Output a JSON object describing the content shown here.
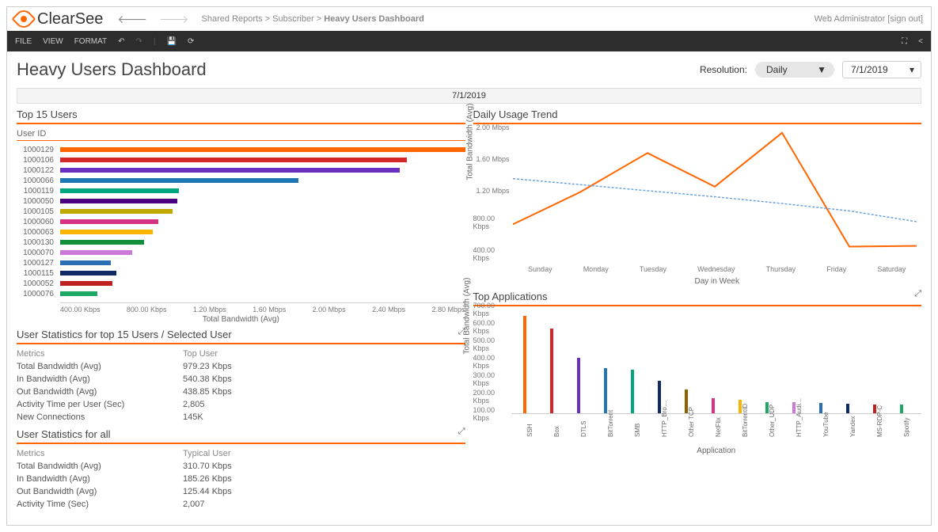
{
  "brand": "ClearSee",
  "breadcrumb": {
    "root": "Shared Reports",
    "mid": "Subscriber",
    "leaf": "Heavy Users Dashboard"
  },
  "user_area": {
    "name": "Web Administrator",
    "signout": "[sign out]"
  },
  "menubar": {
    "file": "FILE",
    "view": "VIEW",
    "format": "FORMAT"
  },
  "page": {
    "title": "Heavy Users Dashboard",
    "resolution_label": "Resolution:",
    "resolution_value": "Daily",
    "date": "7/1/2019",
    "banner_date": "7/1/2019"
  },
  "top15": {
    "title": "Top 15 Users",
    "subtitle": "User ID",
    "users": [
      {
        "id": "1000129",
        "val": 2800,
        "color": "#f60"
      },
      {
        "id": "1000106",
        "val": 2400,
        "color": "#d62728"
      },
      {
        "id": "1000122",
        "val": 2350,
        "color": "#6a2fbd"
      },
      {
        "id": "1000066",
        "val": 1650,
        "color": "#1f77b4"
      },
      {
        "id": "1000119",
        "val": 820,
        "color": "#00a67e"
      },
      {
        "id": "1000050",
        "val": 810,
        "color": "#4b0082"
      },
      {
        "id": "1000105",
        "val": 780,
        "color": "#bfa900"
      },
      {
        "id": "1000060",
        "val": 680,
        "color": "#d63384"
      },
      {
        "id": "1000063",
        "val": 640,
        "color": "#f8b400"
      },
      {
        "id": "1000130",
        "val": 580,
        "color": "#138f3a"
      },
      {
        "id": "1000070",
        "val": 500,
        "color": "#cc79d8"
      },
      {
        "id": "1000127",
        "val": 350,
        "color": "#2a6fb5"
      },
      {
        "id": "1000115",
        "val": 390,
        "color": "#102a66"
      },
      {
        "id": "1000052",
        "val": 360,
        "color": "#c02020"
      },
      {
        "id": "1000076",
        "val": 260,
        "color": "#1ea865"
      }
    ],
    "xticks": [
      "400.00 Kbps",
      "800.00 Kbps",
      "1.20 Mbps",
      "1.60 Mbps",
      "2.00 Mbps",
      "2.40 Mbps",
      "2.80 Mbps"
    ],
    "xlabel": "Total Bandwidth (Avg)"
  },
  "daily": {
    "title": "Daily Usage Trend",
    "ylabel": "Total Bandwidth (Avg)",
    "xlabel": "Day in Week",
    "days": [
      "Sunday",
      "Monday",
      "Tuesday",
      "Wednesday",
      "Thursday",
      "Friday",
      "Saturday"
    ],
    "yticks": [
      "2.00 Mbps",
      "1.60 Mbps",
      "1.20 Mbps",
      "800.00 Kbps",
      "400.00 Kbps"
    ]
  },
  "stats_top15": {
    "title": "User Statistics for top 15 Users / Selected User",
    "h1": "Metrics",
    "h2": "Top User",
    "rows": [
      {
        "m": "Total Bandwidth (Avg)",
        "v": "979.23 Kbps"
      },
      {
        "m": "In Bandwidth (Avg)",
        "v": "540.38 Kbps"
      },
      {
        "m": "Out Bandwidth (Avg)",
        "v": "438.85 Kbps"
      },
      {
        "m": "Activity Time per User (Sec)",
        "v": "2,805"
      },
      {
        "m": "New Connections",
        "v": "145K"
      }
    ]
  },
  "stats_all": {
    "title": "User Statistics for all",
    "h1": "Metrics",
    "h2": "Typical User",
    "rows": [
      {
        "m": "Total Bandwidth (Avg)",
        "v": "310.70 Kbps"
      },
      {
        "m": "In Bandwidth (Avg)",
        "v": "185.26 Kbps"
      },
      {
        "m": "Out Bandwidth (Avg)",
        "v": "125.44 Kbps"
      },
      {
        "m": "Activity Time (Sec)",
        "v": "2,007"
      }
    ]
  },
  "apps": {
    "title": "Top Applications",
    "ylabel": "Total Bandwidth (Avg)",
    "xlabel": "Application",
    "yticks": [
      "700.00 Kbps",
      "600.00 Kbps",
      "500.00 Kbps",
      "400.00 Kbps",
      "300.00 Kbps",
      "200.00 Kbps",
      "100.00 Kbps"
    ],
    "items": [
      {
        "name": "SSH",
        "val": 650,
        "color": "#f60"
      },
      {
        "name": "Box",
        "val": 570,
        "color": "#d62728"
      },
      {
        "name": "DTLS",
        "val": 370,
        "color": "#6a2fbd"
      },
      {
        "name": "BitTorrent",
        "val": 300,
        "color": "#1f77b4"
      },
      {
        "name": "SMB",
        "val": 290,
        "color": "#00a67e"
      },
      {
        "name": "HTTP_Bro…",
        "val": 220,
        "color": "#102a66"
      },
      {
        "name": "Other TCP",
        "val": 160,
        "color": "#8c6200"
      },
      {
        "name": "NetFlix",
        "val": 100,
        "color": "#d63384"
      },
      {
        "name": "BitTorrentID",
        "val": 90,
        "color": "#f8b400"
      },
      {
        "name": "Other_UDP",
        "val": 75,
        "color": "#1ea865"
      },
      {
        "name": "HTTP_Audi…",
        "val": 72,
        "color": "#cc79d8"
      },
      {
        "name": "YouTube",
        "val": 70,
        "color": "#2a6fb5"
      },
      {
        "name": "Yandex",
        "val": 65,
        "color": "#0a2a6a"
      },
      {
        "name": "MS-RDP-C",
        "val": 60,
        "color": "#c02020"
      },
      {
        "name": "Spotify",
        "val": 58,
        "color": "#1ea865"
      }
    ]
  },
  "chart_data": [
    {
      "type": "bar",
      "orientation": "horizontal",
      "title": "Top 15 Users",
      "xlabel": "Total Bandwidth (Avg)",
      "ylabel": "User ID",
      "ylim": [
        0,
        2800
      ],
      "categories": [
        "1000129",
        "1000106",
        "1000122",
        "1000066",
        "1000119",
        "1000050",
        "1000105",
        "1000060",
        "1000063",
        "1000130",
        "1000070",
        "1000127",
        "1000115",
        "1000052",
        "1000076"
      ],
      "values": [
        2800,
        2400,
        2350,
        1650,
        820,
        810,
        780,
        680,
        640,
        580,
        500,
        350,
        390,
        360,
        260
      ],
      "unit": "Kbps"
    },
    {
      "type": "line",
      "title": "Daily Usage Trend",
      "xlabel": "Day in Week",
      "ylabel": "Total Bandwidth (Avg)",
      "ylim": [
        0,
        2000
      ],
      "categories": [
        "Sunday",
        "Monday",
        "Tuesday",
        "Wednesday",
        "Thursday",
        "Friday",
        "Saturday"
      ],
      "series": [
        {
          "name": "Orange",
          "values": [
            560,
            1040,
            1620,
            1120,
            1920,
            230,
            240
          ]
        },
        {
          "name": "Blue",
          "values": [
            1240,
            1150,
            1060,
            970,
            870,
            760,
            600
          ]
        }
      ],
      "unit": "Kbps"
    },
    {
      "type": "table",
      "title": "User Statistics for top 15 Users / Selected User",
      "columns": [
        "Metrics",
        "Top User"
      ],
      "rows": [
        [
          "Total Bandwidth (Avg)",
          "979.23 Kbps"
        ],
        [
          "In Bandwidth (Avg)",
          "540.38 Kbps"
        ],
        [
          "Out Bandwidth (Avg)",
          "438.85 Kbps"
        ],
        [
          "Activity Time per User (Sec)",
          "2,805"
        ],
        [
          "New Connections",
          "145K"
        ]
      ]
    },
    {
      "type": "table",
      "title": "User Statistics for all",
      "columns": [
        "Metrics",
        "Typical User"
      ],
      "rows": [
        [
          "Total Bandwidth (Avg)",
          "310.70 Kbps"
        ],
        [
          "In Bandwidth (Avg)",
          "185.26 Kbps"
        ],
        [
          "Out Bandwidth (Avg)",
          "125.44 Kbps"
        ],
        [
          "Activity Time (Sec)",
          "2,007"
        ]
      ]
    },
    {
      "type": "bar",
      "title": "Top Applications",
      "xlabel": "Application",
      "ylabel": "Total Bandwidth (Avg)",
      "ylim": [
        0,
        700
      ],
      "categories": [
        "SSH",
        "Box",
        "DTLS",
        "BitTorrent",
        "SMB",
        "HTTP_Bro…",
        "Other TCP",
        "NetFlix",
        "BitTorrentID",
        "Other_UDP",
        "HTTP_Audi…",
        "YouTube",
        "Yandex",
        "MS-RDP-C",
        "Spotify"
      ],
      "values": [
        650,
        570,
        370,
        300,
        290,
        220,
        160,
        100,
        90,
        75,
        72,
        70,
        65,
        60,
        58
      ],
      "unit": "Kbps"
    }
  ]
}
